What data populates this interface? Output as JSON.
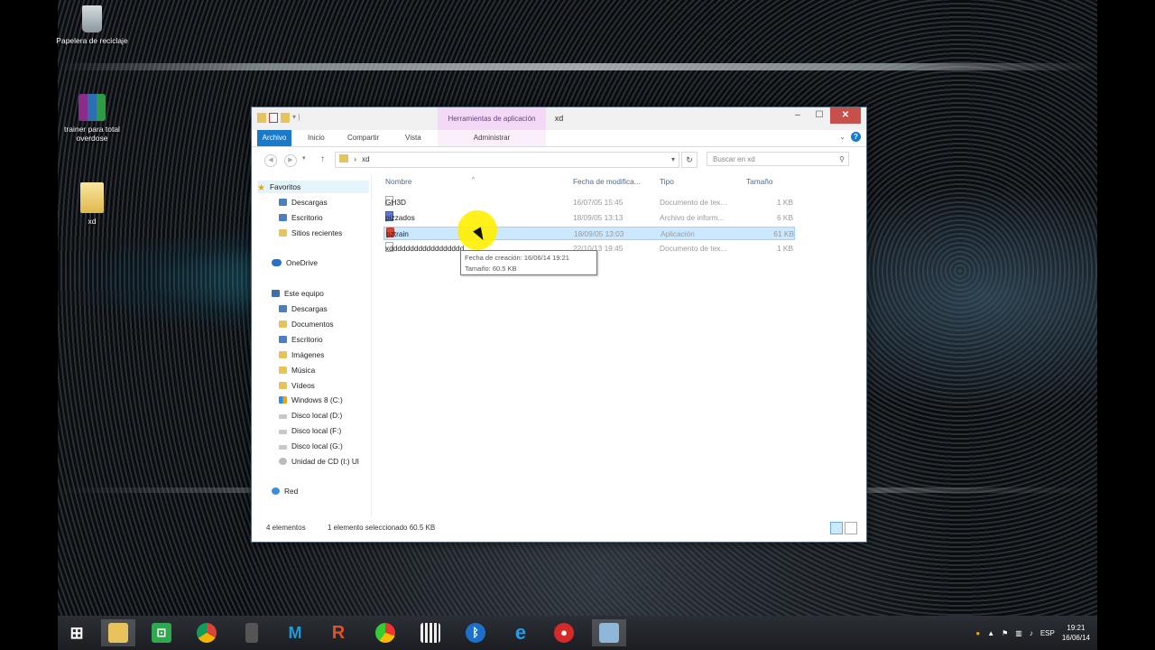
{
  "desktop": {
    "icons": [
      {
        "label": "Papelera de reciclaje"
      },
      {
        "label": "trainer para total overdose"
      },
      {
        "label": "xd"
      }
    ]
  },
  "window": {
    "title": "xd",
    "context_tab": "Herramientas de aplicación",
    "ribbon_tabs": [
      "Archivo",
      "Inicio",
      "Compartir",
      "Vista",
      "Administrar"
    ],
    "controls": {
      "minimize": "‒",
      "maximize": "☐",
      "close": "✕"
    },
    "address": {
      "path": "xd",
      "separator": "›"
    },
    "search": {
      "placeholder": "Buscar en xd"
    },
    "nav": {
      "favorites": {
        "label": "Favoritos",
        "items": [
          "Descargas",
          "Escritorio",
          "Sitios recientes"
        ]
      },
      "onedrive": "OneDrive",
      "thispc": {
        "label": "Este equipo",
        "items": [
          "Descargas",
          "Documentos",
          "Escritorio",
          "Imágenes",
          "Música",
          "Vídeos",
          "Windows 8 (C:)",
          "Disco local (D:)",
          "Disco local (F:)",
          "Disco local (G:)",
          "Unidad de CD (I:) Ul"
        ]
      },
      "network": "Red"
    },
    "columns": [
      "Nombre",
      "Fecha de modifica...",
      "Tipo",
      "Tamaño"
    ],
    "files": [
      {
        "name": "GH3D",
        "date": "16/07/05 15:45",
        "type": "Documento de tex...",
        "size": "1 KB"
      },
      {
        "name": "pizzados",
        "date": "18/09/05 13:13",
        "type": "Archivo de inform...",
        "size": "6 KB"
      },
      {
        "name": "pztrain",
        "date": "18/09/05 13:03",
        "type": "Aplicación",
        "size": "61 KB"
      },
      {
        "name": "xdddddddddddddddddd",
        "date": "22/10/13 19:45",
        "type": "Documento de tex...",
        "size": "1 KB"
      }
    ],
    "tooltip": {
      "line1": "Fecha de creación: 16/06/14 19:21",
      "line2": "Tamaño: 60.5 KB"
    },
    "status": {
      "count": "4 elementos",
      "selection": "1 elemento seleccionado  60.5 KB"
    }
  },
  "taskbar": {
    "apps": [
      "start",
      "file-explorer",
      "store",
      "chrome",
      "tablet",
      "movistar",
      "r-app",
      "gauge",
      "piano",
      "bluetooth",
      "internet-explorer",
      "record",
      "photo"
    ],
    "tray": {
      "lang": "ESP",
      "time": "19:21",
      "date": "16/06/14"
    }
  },
  "colors": {
    "accent": "#1979ca",
    "close": "#c7504a",
    "selection": "#cce8ff",
    "context": "#f4d9f7"
  }
}
